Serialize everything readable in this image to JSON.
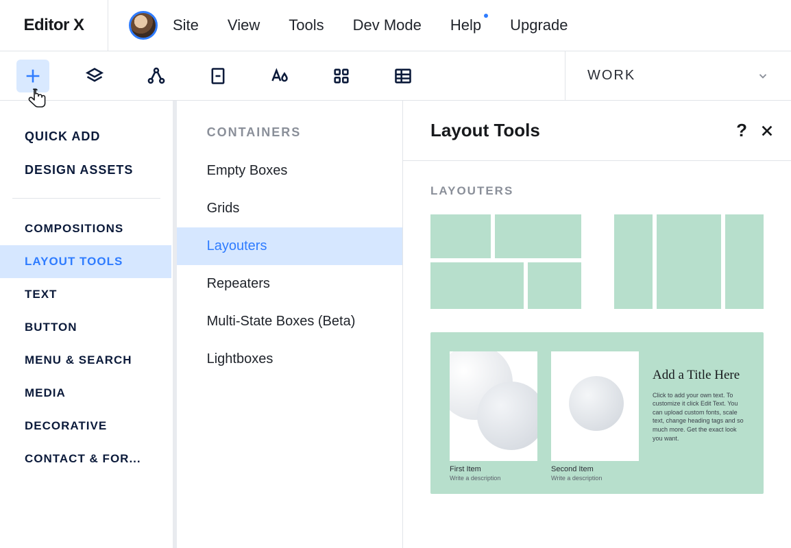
{
  "app": {
    "logo": "Editor X"
  },
  "menubar": {
    "items": [
      "Site",
      "View",
      "Tools",
      "Dev Mode",
      "Help",
      "Upgrade"
    ],
    "help_has_dot": true
  },
  "toolbar": {
    "page_selector": "WORK"
  },
  "sidebar1": {
    "quick_add": "QUICK ADD",
    "design_assets": "DESIGN ASSETS",
    "categories": [
      "COMPOSITIONS",
      "LAYOUT TOOLS",
      "TEXT",
      "BUTTON",
      "MENU & SEARCH",
      "MEDIA",
      "DECORATIVE",
      "CONTACT & FOR..."
    ],
    "active_index": 1
  },
  "sidebar2": {
    "section": "CONTAINERS",
    "items": [
      "Empty Boxes",
      "Grids",
      "Layouters",
      "Repeaters",
      "Multi-State Boxes (Beta)",
      "Lightboxes"
    ],
    "active_index": 2
  },
  "panel": {
    "title": "Layout Tools",
    "subsection": "LAYOUTERS",
    "card": {
      "first_label": "First Item",
      "first_sub": "Write a description",
      "second_label": "Second Item",
      "second_sub": "Write a description",
      "text_title": "Add a Title Here",
      "text_desc": "Click to add your own text. To customize it click Edit Text. You can upload custom fonts, scale text, change heading tags and so much more. Get the exact look you want."
    }
  }
}
